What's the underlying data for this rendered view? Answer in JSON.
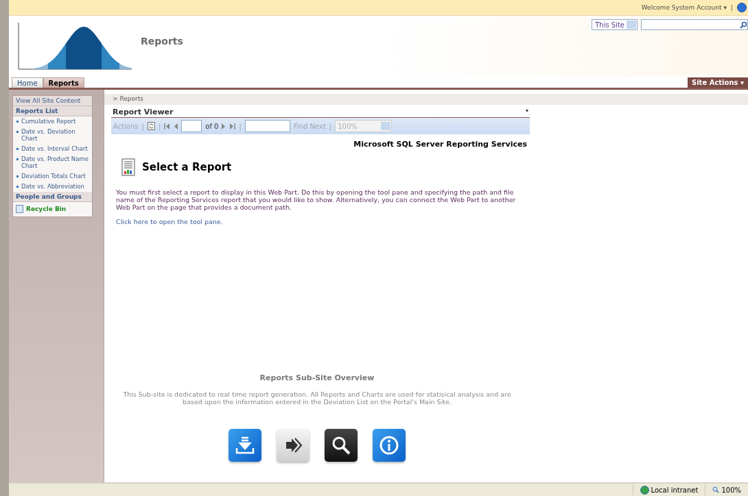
{
  "top_bar": {
    "welcome": "Welcome System Account",
    "welcome_caret": "▾",
    "separator": "|"
  },
  "header": {
    "site_title": "Reports",
    "scope_select": "This Site"
  },
  "tabs": [
    {
      "label": "Home",
      "selected": false
    },
    {
      "label": "Reports",
      "selected": true
    }
  ],
  "site_actions": {
    "label": "Site Actions",
    "caret": "▾"
  },
  "quick_launch": {
    "view_all": "View All Site Content",
    "sections": [
      {
        "title": "Reports List",
        "items": [
          "Cumulative Report",
          "Date vs. Deviation Chart",
          "Date vs. Interval Chart",
          "Date vs. Product Name Chart",
          "Deviation Totals Chart",
          "Date vs. Abbreviation"
        ]
      },
      {
        "title": "People and Groups"
      }
    ],
    "recycle_bin": "Recycle Bin"
  },
  "breadcrumb": "> Reports",
  "report_viewer": {
    "title": "Report Viewer",
    "menu_caret": "▾",
    "toolbar": {
      "actions": "Actions",
      "separator": "|",
      "of_pages": "of 0",
      "find_next": "Find Next",
      "zoom": "100%"
    },
    "product": "Microsoft SQL Server Reporting Services",
    "heading": "Select a Report",
    "message": "You must first select a report to display in this Web Part. Do this by opening the tool pane and specifying the path and file name of the Reporting Services report that you would like to show. Alternatively, you can connect the Web Part to another Web Part on the page that provides a document path.",
    "link": "Click here to open the tool pane."
  },
  "overview": {
    "title": "Reports Sub-Site Overview",
    "text": "This Sub-site is dedicated to real time report generation. All Reports and Charts are used for statisical analysis and are based upon the information entered in the Deviation List on the Portal's Main Site.",
    "tiles": [
      {
        "kind": "download"
      },
      {
        "kind": "forward"
      },
      {
        "kind": "search"
      },
      {
        "kind": "info"
      }
    ]
  },
  "status_bar": {
    "zone": "Local intranet",
    "zoom": "100%"
  }
}
